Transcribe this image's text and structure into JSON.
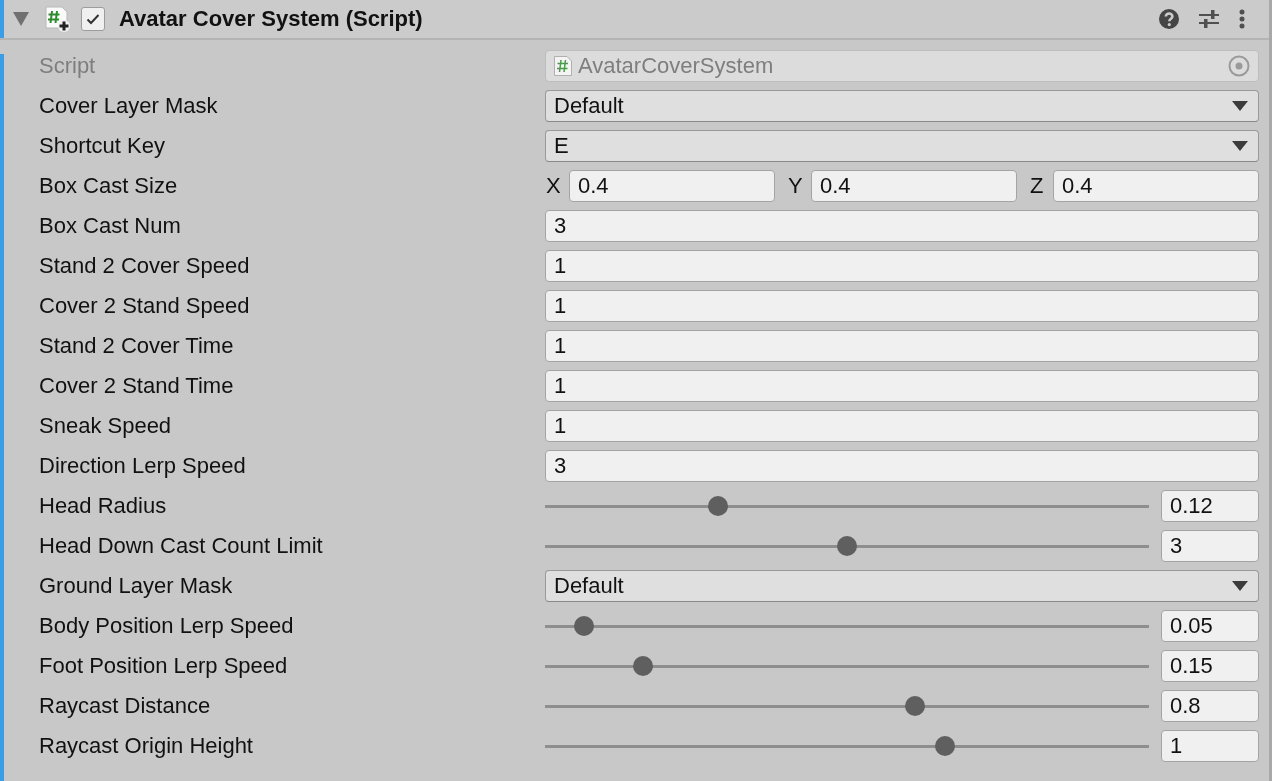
{
  "component": {
    "title": "Avatar Cover System (Script)",
    "expanded": true,
    "enabled": true
  },
  "properties": [
    {
      "kind": "object",
      "label": "Script",
      "value": "AvatarCoverSystem",
      "disabled": true
    },
    {
      "kind": "dropdown",
      "label": "Cover Layer Mask",
      "value": "Default",
      "disabled": false
    },
    {
      "kind": "dropdown",
      "label": "Shortcut Key",
      "value": "E",
      "disabled": false
    },
    {
      "kind": "vector3",
      "label": "Box Cast Size",
      "components": [
        {
          "axis": "X",
          "value": "0.4"
        },
        {
          "axis": "Y",
          "value": "0.4"
        },
        {
          "axis": "Z",
          "value": "0.4"
        }
      ],
      "disabled": false
    },
    {
      "kind": "number",
      "label": "Box Cast Num",
      "value": "3",
      "disabled": false
    },
    {
      "kind": "number",
      "label": "Stand 2 Cover Speed",
      "value": "1",
      "disabled": false
    },
    {
      "kind": "number",
      "label": "Cover 2 Stand Speed",
      "value": "1",
      "disabled": false
    },
    {
      "kind": "number",
      "label": "Stand 2 Cover Time",
      "value": "1",
      "disabled": false
    },
    {
      "kind": "number",
      "label": "Cover 2 Stand Time",
      "value": "1",
      "disabled": false
    },
    {
      "kind": "number",
      "label": "Sneak Speed",
      "value": "1",
      "disabled": false
    },
    {
      "kind": "number",
      "label": "Direction Lerp Speed",
      "value": "3",
      "disabled": false
    },
    {
      "kind": "slider",
      "label": "Head Radius",
      "level": 0.287,
      "value": "0.12",
      "disabled": false
    },
    {
      "kind": "slider",
      "label": "Head Down Cast Count Limit",
      "level": 0.5,
      "value": "3",
      "disabled": false
    },
    {
      "kind": "dropdown",
      "label": "Ground Layer Mask",
      "value": "Default",
      "disabled": false
    },
    {
      "kind": "slider",
      "label": "Body Position Lerp Speed",
      "level": 0.064,
      "value": "0.05",
      "disabled": false
    },
    {
      "kind": "slider",
      "label": "Foot Position Lerp Speed",
      "level": 0.162,
      "value": "0.15",
      "disabled": false
    },
    {
      "kind": "slider",
      "label": "Raycast Distance",
      "level": 0.612,
      "value": "0.8",
      "disabled": false
    },
    {
      "kind": "slider",
      "label": "Raycast Origin Height",
      "level": 0.662,
      "value": "1",
      "disabled": false
    }
  ]
}
